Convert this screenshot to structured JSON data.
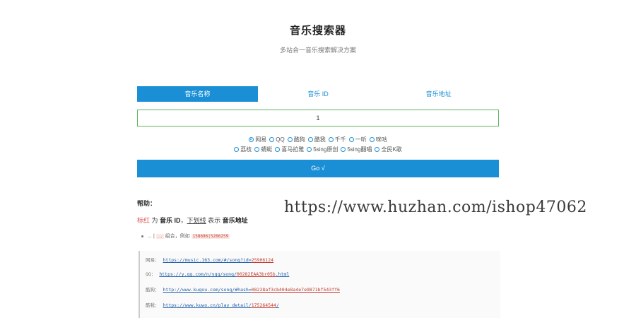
{
  "header": {
    "title": "音乐搜索器",
    "subtitle": "多站合一音乐搜索解决方案"
  },
  "tabs": [
    {
      "label": "音乐名称",
      "active": true
    },
    {
      "label": "音乐 ID",
      "active": false
    },
    {
      "label": "音乐地址",
      "active": false
    }
  ],
  "search": {
    "value": "1"
  },
  "sources_row1": [
    {
      "label": "网易",
      "checked": true
    },
    {
      "label": "QQ",
      "checked": false
    },
    {
      "label": "酷狗",
      "checked": false
    },
    {
      "label": "酷我",
      "checked": false
    },
    {
      "label": "千千",
      "checked": false
    },
    {
      "label": "一听",
      "checked": false
    },
    {
      "label": "咪咕",
      "checked": false
    }
  ],
  "sources_row2": [
    {
      "label": "荔枝",
      "checked": false
    },
    {
      "label": "蜻蜓",
      "checked": false
    },
    {
      "label": "喜马拉雅",
      "checked": false
    },
    {
      "label": "5sing原创",
      "checked": false
    },
    {
      "label": "5sing翻唱",
      "checked": false
    },
    {
      "label": "全民K歌",
      "checked": false
    }
  ],
  "go_label": "Go √",
  "help": {
    "title": "帮助：",
    "legend_red": "标红",
    "legend_mid1": " 为 ",
    "legend_id": "音乐 ID",
    "legend_mid2": "，",
    "legend_underline": "下划线",
    "legend_mid3": " 表示 ",
    "legend_addr": "音乐地址",
    "note_text": "…",
    "note_sep": " | ",
    "note_tag": "…",
    "note_suffix": " 组合，例如 ",
    "note_example": "158696|5266259"
  },
  "watermark": "https://www.huzhan.com/ishop47062",
  "examples": [
    {
      "label": "网易：",
      "url": "https://music.163.com/#/song?id=",
      "hl": "25906124"
    },
    {
      "label": "QQ：",
      "url": "https://y.qq.com/n/yqq/song/",
      "hl": "00282EAA3br05b",
      "suffix": ".html"
    },
    {
      "label": "酷狗：",
      "url": "http://www.kugou.com/song/#hash=",
      "hl": "08228af3cb404e8a4e7e9871bf543ff6"
    },
    {
      "label": "酷我：",
      "url": "https://www.kuwo.cn/play_detail/",
      "hl": "175264544",
      "suffix": "/"
    },
    {
      "label": "…",
      "url": "…"
    }
  ]
}
